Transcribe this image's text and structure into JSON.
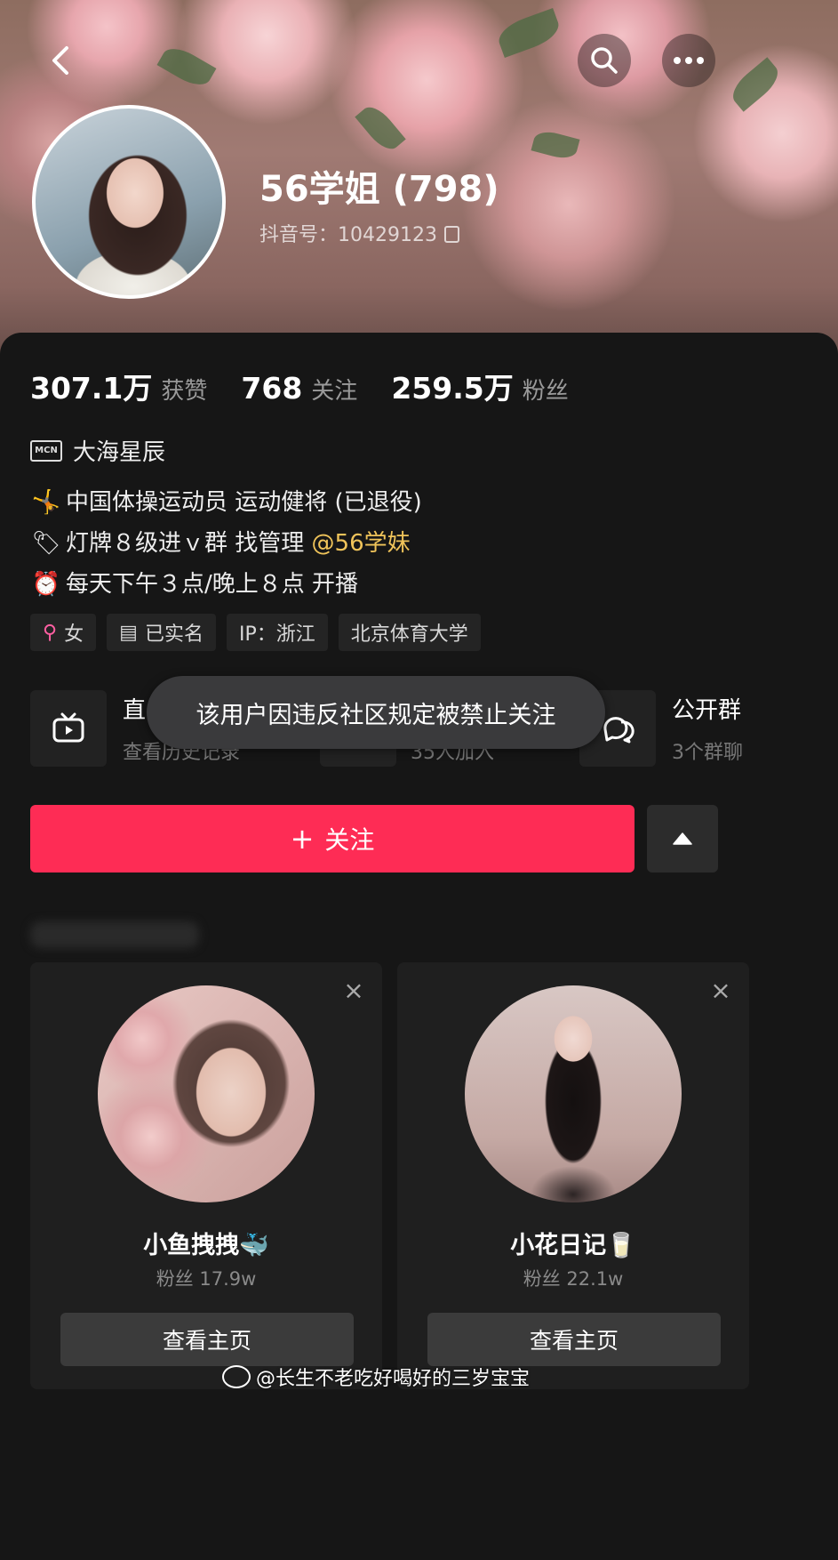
{
  "profile": {
    "name": "56学姐 (798)",
    "douyin_id": "抖音号：10429123"
  },
  "stats": [
    {
      "num": "307.1万",
      "label": "获赞"
    },
    {
      "num": "768",
      "label": "关注"
    },
    {
      "num": "259.5万",
      "label": "粉丝"
    }
  ],
  "mcn": {
    "badge": "MCN",
    "name": "大海星辰"
  },
  "bio": {
    "line1": {
      "emoji": "🤸",
      "text": "中国体操运动员 运动健将 (已退役)"
    },
    "line2": {
      "emoji": "🏷",
      "text": "灯牌８级进ｖ群 找管理",
      "mention": "@56学妹"
    },
    "line3": {
      "emoji": "⏰",
      "text": "每天下午３点/晚上８点 开播"
    }
  },
  "tags": [
    {
      "icon": "⚲",
      "label": "女"
    },
    {
      "icon": "▤",
      "label": "已实名"
    },
    {
      "icon": "",
      "label": "IP：浙江"
    },
    {
      "icon": "",
      "label": "北京体育大学"
    }
  ],
  "entries": {
    "live": {
      "title": "直",
      "sub": "查看历史记录"
    },
    "fans_group": {
      "sub": "35人加入"
    },
    "public_group": {
      "title": "公开群",
      "sub": "3个群聊"
    }
  },
  "toast": "该用户因违反社区规定被禁止关注",
  "follow_button": {
    "plus": "+",
    "label": "关注"
  },
  "recommendations": [
    {
      "name": "小鱼拽拽🐳",
      "fans": "粉丝 17.9w",
      "button": "查看主页"
    },
    {
      "name": "小花日记🥛",
      "fans": "粉丝 22.1w",
      "button": "查看主页"
    }
  ],
  "watermark": "@长生不老吃好喝好的三岁宝宝",
  "colors": {
    "accent": "#fe2c55",
    "mention": "#f0c45a",
    "background": "#161616"
  }
}
